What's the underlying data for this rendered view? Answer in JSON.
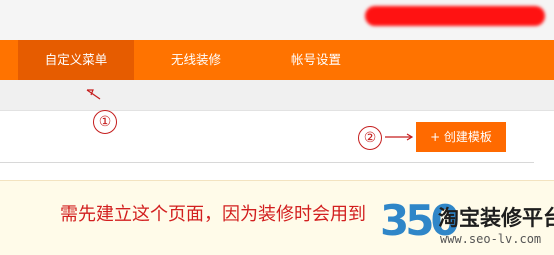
{
  "nav": {
    "tabs": [
      {
        "label": "自定义菜单",
        "active": true
      },
      {
        "label": "无线装修",
        "active": false
      },
      {
        "label": "帐号设置",
        "active": false
      }
    ]
  },
  "toolbar": {
    "create_template_label": "+ 创建模板"
  },
  "annotations": {
    "marker_1": "①",
    "marker_2": "②",
    "note": "需先建立这个页面，因为装修时会用到"
  },
  "watermark": {
    "number": "350",
    "name": "淘宝装修平台",
    "url": "www.seo-lv.com"
  },
  "colors": {
    "nav_bg": "#ff7300",
    "nav_active_bg": "#e65c00",
    "button_bg": "#ff6a00",
    "annotation_red": "#c51e1e"
  }
}
